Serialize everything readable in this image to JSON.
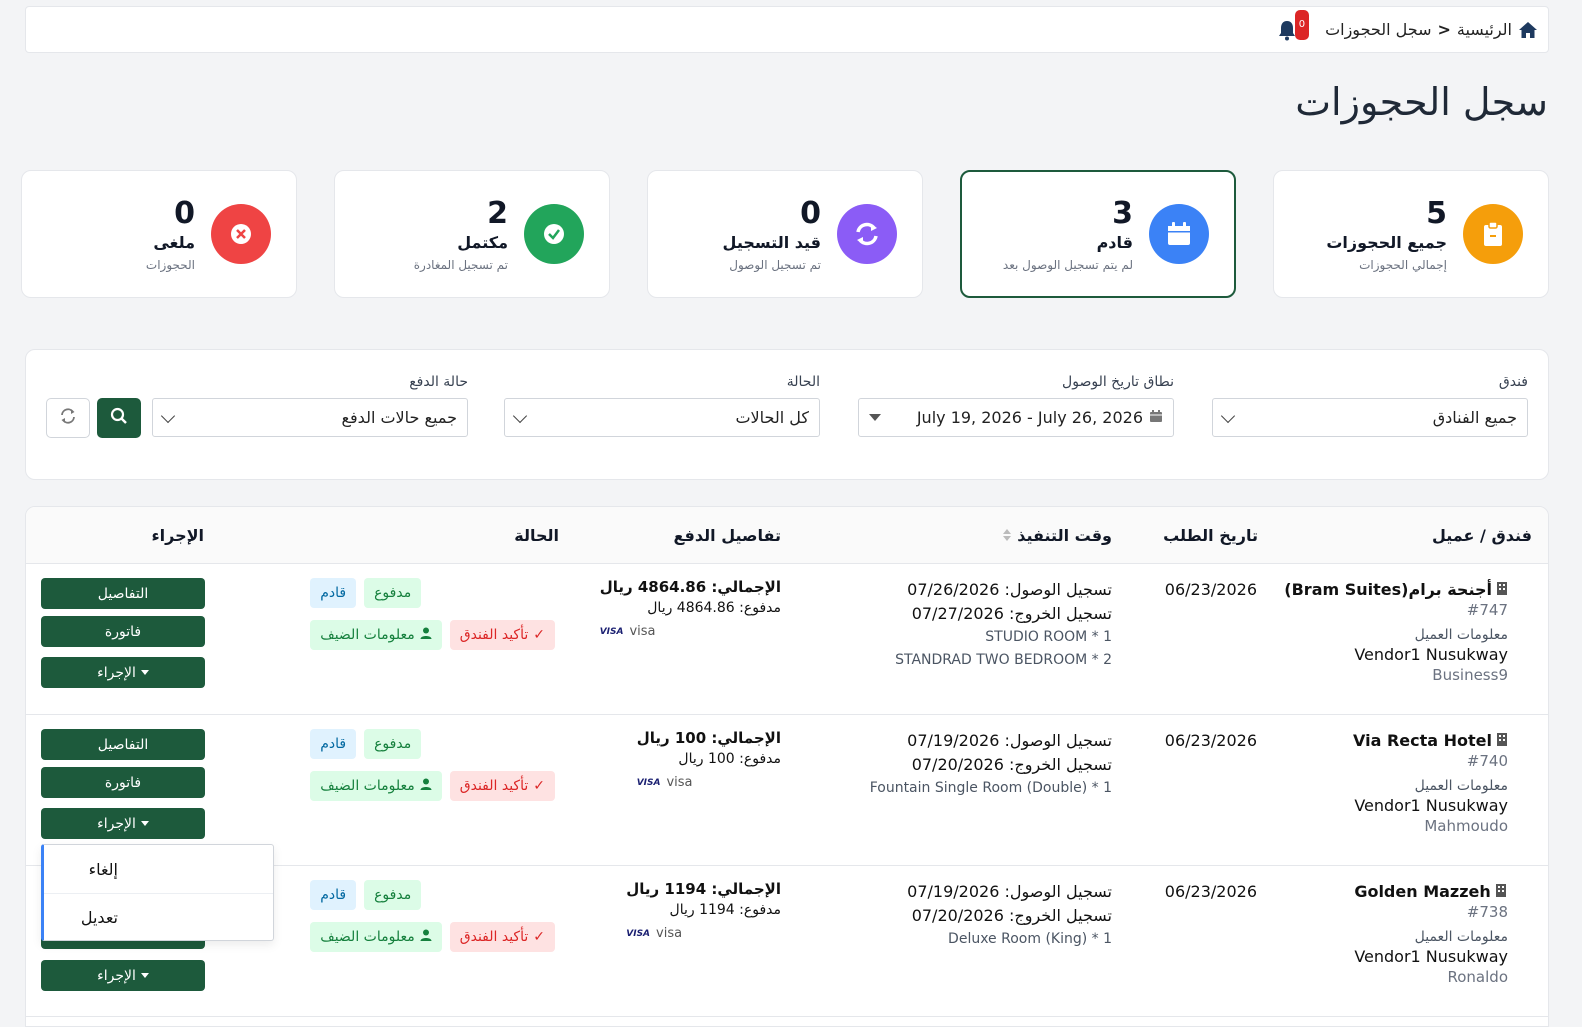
{
  "breadcrumb": {
    "home": "الرئيسية",
    "separator": "<",
    "current": "سجل الحجوزات"
  },
  "notifications": {
    "count": "0"
  },
  "page": {
    "title": "سجل الحجوزات"
  },
  "stats": [
    {
      "count": "5",
      "title": "جميع الحجوزات",
      "subtitle": "إجمالي الحجوزات",
      "color": "#f59e0b",
      "icon": "clipboard-icon"
    },
    {
      "count": "3",
      "title": "قادم",
      "subtitle": "لم يتم تسجيل الوصول بعد",
      "color": "#3b82f6",
      "icon": "calendar-icon"
    },
    {
      "count": "0",
      "title": "قيد التسجيل",
      "subtitle": "تم تسجيل الوصول",
      "color": "#8b5cf6",
      "icon": "refresh-icon"
    },
    {
      "count": "2",
      "title": "مكتمل",
      "subtitle": "تم تسجيل المغادرة",
      "color": "#22a55b",
      "icon": "check-circle-icon"
    },
    {
      "count": "0",
      "title": "ملغى",
      "subtitle": "الحجوزات",
      "color": "#ef4444",
      "icon": "x-circle-icon"
    }
  ],
  "filters": {
    "hotel": {
      "label": "فندق",
      "value": "جميع الفنادق"
    },
    "date_range": {
      "label": "نطاق تاريخ الوصول",
      "value": "July 19, 2026 - July 26, 2026"
    },
    "status": {
      "label": "الحالة",
      "value": "كل الحالات"
    },
    "payment_status": {
      "label": "حالة الدفع",
      "value": "جميع حالات الدفع"
    }
  },
  "table": {
    "headers": {
      "hotel_customer": "فندق / عميل",
      "request_date": "تاريخ الطلب",
      "execution_time": "وقت التنفيذ",
      "payment_details": "تفاصيل الدفع",
      "status": "الحالة",
      "action": "الإجراء"
    },
    "rows": [
      {
        "hotel": "أجنحة برام(Bram Suites)",
        "id": "#747",
        "customer_label": "معلومات العميل",
        "customer_name": "Vendor1 Nusukway",
        "customer_user": "Business9",
        "request_date": "06/23/2026",
        "checkin": "تسجيل الوصول: 07/26/2026",
        "checkout": "تسجيل الخروج: 07/27/2026",
        "rooms": [
          "STUDIO ROOM * 1",
          "STANDRAD TWO BEDROOM * 2"
        ],
        "total": "الإجمالي: 4864.86 ريال",
        "paid": "مدفوع: 4864.86 ريال",
        "method": "visa",
        "badge_status": "قادم",
        "badge_paid": "مدفوع",
        "badge_guest": "معلومات الضيف",
        "badge_confirm": "تأكيد الفندق",
        "btn_details": "التفاصيل",
        "btn_invoice": "فاتورة",
        "btn_action": "الإجراء"
      },
      {
        "hotel": "Via Recta Hotel",
        "id": "#740",
        "customer_label": "معلومات العميل",
        "customer_name": "Vendor1 Nusukway",
        "customer_user": "Mahmoudo",
        "request_date": "06/23/2026",
        "checkin": "تسجيل الوصول: 07/19/2026",
        "checkout": "تسجيل الخروج: 07/20/2026",
        "rooms": [
          "Fountain Single Room (Double) * 1"
        ],
        "total": "الإجمالي: 100 ريال",
        "paid": "مدفوع: 100 ريال",
        "method": "visa",
        "badge_status": "قادم",
        "badge_paid": "مدفوع",
        "badge_guest": "معلومات الضيف",
        "badge_confirm": "تأكيد الفندق",
        "btn_details": "التفاصيل",
        "btn_invoice": "فاتورة",
        "btn_action": "الإجراء"
      },
      {
        "hotel": "Golden Mazzeh",
        "id": "#738",
        "customer_label": "معلومات العميل",
        "customer_name": "Vendor1 Nusukway",
        "customer_user": "Ronaldo",
        "request_date": "06/23/2026",
        "checkin": "تسجيل الوصول: 07/19/2026",
        "checkout": "تسجيل الخروج: 07/20/2026",
        "rooms": [
          "Deluxe Room (King) * 1"
        ],
        "total": "الإجمالي: 1194 ريال",
        "paid": "مدفوع: 1194 ريال",
        "method": "visa",
        "badge_status": "قادم",
        "badge_paid": "مدفوع",
        "badge_guest": "معلومات الضيف",
        "badge_confirm": "تأكيد الفندق",
        "btn_action": "الإجراء"
      }
    ]
  },
  "action_menu": {
    "items": [
      "إلغاء",
      "تعديل"
    ]
  },
  "colors": {
    "primary": "#1d5a3c",
    "badge_blue": "#0369a1",
    "badge_green": "#15803d",
    "badge_red": "#dc2626"
  },
  "visa_mark": "VISA"
}
